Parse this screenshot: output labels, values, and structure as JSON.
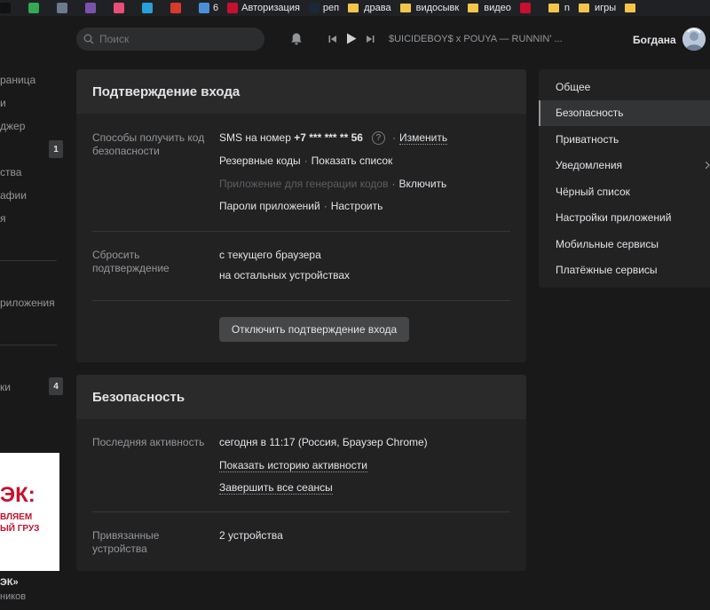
{
  "bookmarks": [
    {
      "label": "",
      "icon": "tiktok-icon",
      "color": "#111111"
    },
    {
      "label": "",
      "icon": "google-drive-icon",
      "color": "#34a853"
    },
    {
      "label": "",
      "icon": "photo-icon",
      "color": "#6b7a8f"
    },
    {
      "label": "",
      "icon": "s-icon",
      "color": "#7b52ab"
    },
    {
      "label": "",
      "icon": "colorful-icon",
      "color": "#e94e77"
    },
    {
      "label": "",
      "icon": "sail-icon",
      "color": "#2b9fd9"
    },
    {
      "label": "",
      "icon": "d-icon",
      "color": "#d93a2b"
    },
    {
      "label": "6",
      "icon": "six-icon",
      "color": "#4a90d9"
    },
    {
      "label": "Авторизация",
      "icon": "ttk-icon",
      "color": "#c8102e"
    },
    {
      "label": "реп",
      "icon": "steam-icon",
      "color": "#1b2838"
    },
    {
      "label": "драва",
      "icon": "folder-icon",
      "color": "#f3c54a"
    },
    {
      "label": "видосывк",
      "icon": "folder-icon",
      "color": "#f3c54a"
    },
    {
      "label": "видео",
      "icon": "folder-icon",
      "color": "#f3c54a"
    },
    {
      "label": "",
      "icon": "e-icon",
      "color": "#c8102e"
    },
    {
      "label": "n",
      "icon": "folder-icon",
      "color": "#f3c54a"
    },
    {
      "label": "игры",
      "icon": "folder-icon",
      "color": "#f3c54a"
    },
    {
      "label": "",
      "icon": "folder-icon",
      "color": "#f3c54a"
    }
  ],
  "header": {
    "search_placeholder": "Поиск",
    "track": "$UICIDEBOY$ x POUYA — RUNNIN' ...",
    "user_name": "Богдана"
  },
  "leftnav": {
    "items": [
      "раница",
      "и",
      "джер",
      "ства",
      "афии",
      "я",
      "риложения",
      "ки"
    ],
    "badge1": "1",
    "badge2": "4"
  },
  "ad": {
    "logo": "ЭК:",
    "line1": "ВЛЯЕМ",
    "line2": "ЫЙ ГРУЗ",
    "name": "ЭК»",
    "sub": "ников"
  },
  "login_confirm": {
    "title": "Подтверждение входа",
    "methods_label": "Способы получить код безопасности",
    "sms_prefix": "SMS на номер ",
    "sms_number": "+7 *** *** ** 56",
    "help": "?",
    "change": "Изменить",
    "reserve_codes": "Резервные коды",
    "show_list": "Показать список",
    "app_gen": "Приложение для генерации кодов",
    "enable": "Включить",
    "app_passwords": "Пароли приложений",
    "configure": "Настроить",
    "reset_label": "Сбросить подтверждение",
    "reset_current": "с текущего браузера",
    "reset_others": "на остальных устройствах",
    "disable_button": "Отключить подтверждение входа",
    "dot": "·"
  },
  "security": {
    "title": "Безопасность",
    "last_activity_label": "Последняя активность",
    "last_activity_value": "сегодня в 11:17 (Россия, Браузер Chrome)",
    "show_history": "Показать историю активности",
    "end_sessions": "Завершить все сеансы",
    "linked_label": "Привязанные устройства",
    "linked_value": "2 устройства"
  },
  "settings_menu": {
    "items": [
      "Общее",
      "Безопасность",
      "Приватность",
      "Уведомления",
      "Чёрный список",
      "Настройки приложений",
      "Мобильные сервисы",
      "Платёжные сервисы"
    ],
    "active": "Безопасность"
  }
}
